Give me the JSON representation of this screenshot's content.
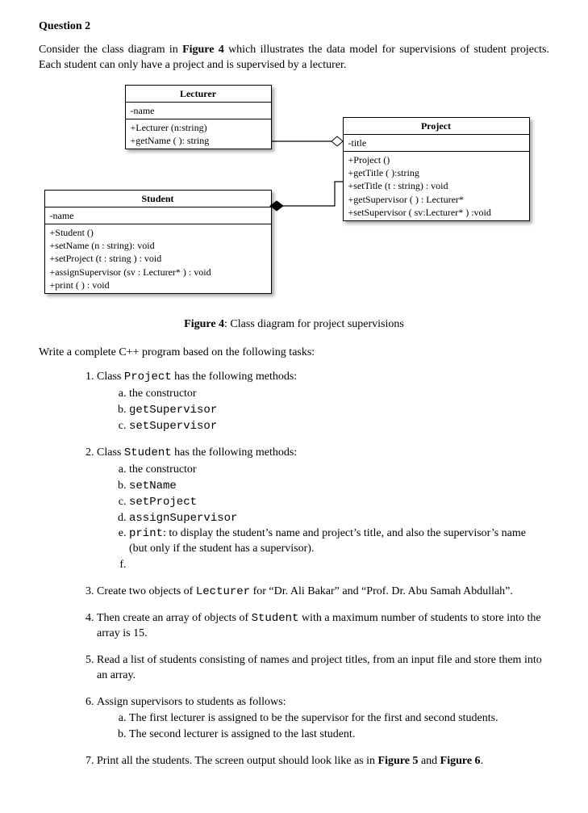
{
  "title": "Question 2",
  "intro_a": "Consider the class diagram in ",
  "intro_b": " which illustrates the data model for supervisions of student projects. Each student can only have a project and is supervised by a lecturer.",
  "fig4_ref": "Figure 4",
  "uml": {
    "lecturer": {
      "name": "Lecturer",
      "attr1": "-name",
      "op1": "+Lecturer (n:string)",
      "op2": "+getName ( ): string"
    },
    "student": {
      "name": "Student",
      "attr1": "-name",
      "op1": "+Student ()",
      "op2": "+setName (n : string): void",
      "op3": "+setProject (t : string ) : void",
      "op4": "+assignSupervisor (sv : Lecturer* ) : void",
      "op5": "+print ( ) : void"
    },
    "project": {
      "name": "Project",
      "attr1": "-title",
      "op1": "+Project ()",
      "op2": "+getTitle ( ):string",
      "op3": "+setTitle (t : string) : void",
      "op4": "+getSupervisor ( ) : Lecturer*",
      "op5": "+setSupervisor ( sv:Lecturer* ) :void"
    }
  },
  "fig_caption_prefix": "Figure 4",
  "fig_caption_rest": ": Class diagram for project supervisions",
  "write_line": "Write a complete C++ program based on the following tasks:",
  "t1": {
    "lead_a": "Class ",
    "code": "Project",
    "lead_b": " has the following methods:",
    "a": "the constructor",
    "b": "getSupervisor",
    "c": "setSupervisor"
  },
  "t2": {
    "lead_a": "Class ",
    "code": "Student",
    "lead_b": " has the following methods:",
    "a": "the constructor",
    "b": "setName",
    "c": "setProject",
    "d": "assignSupervisor",
    "e_code": "print",
    "e_rest": ": to display the student’s name and project’s title, and also the supervisor’s name (but only if the student has a supervisor).",
    "f": ""
  },
  "t3": {
    "a": "Create two objects of ",
    "code": "Lecturer",
    "b": " for “Dr. Ali Bakar” and “Prof. Dr. Abu Samah Abdullah”."
  },
  "t4": {
    "a": "Then create an array of objects of ",
    "code": "Student",
    "b": " with a maximum number of students to store into the array is 15."
  },
  "t5": "Read a list of students consisting of names and project titles, from an input file and store them into an array.",
  "t6": {
    "lead": "Assign supervisors to students as follows:",
    "a": "The first lecturer is assigned to be the supervisor for the first and second students.",
    "b": "The second lecturer is assigned to the last student."
  },
  "t7": {
    "a": "Print all the students. The screen output should look like as in ",
    "f5": "Figure 5",
    "and": " and ",
    "f6": "Figure 6",
    "dot": "."
  }
}
